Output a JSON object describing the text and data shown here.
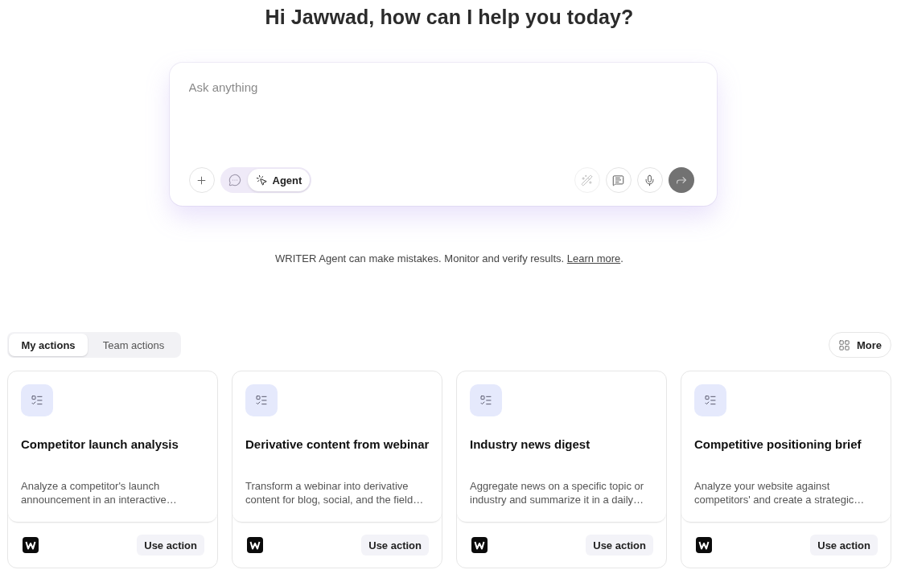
{
  "heading": "Hi Jawwad, how can I help you today?",
  "composer": {
    "placeholder": "Ask anything",
    "modes": [
      {
        "kind": "chat",
        "selected": false
      },
      {
        "kind": "agent",
        "label": "Agent",
        "selected": true
      }
    ],
    "tools": [
      {
        "kind": "enhance",
        "disabled": true
      },
      {
        "kind": "notes",
        "disabled": false
      },
      {
        "kind": "voice",
        "disabled": false
      }
    ],
    "send": {
      "disabled": true
    }
  },
  "disclaimer": {
    "text": "WRITER Agent can make mistakes. Monitor and verify results.",
    "link": "Learn more",
    "trailing": "."
  },
  "tabs": [
    {
      "label": "My actions",
      "selected": true
    },
    {
      "label": "Team actions",
      "selected": false
    }
  ],
  "more_button": {
    "label": "More"
  },
  "actions": [
    {
      "title": "Competitor launch analysis",
      "description": "Analyze a competitor's launch announcement in an interactive…",
      "button": "Use action"
    },
    {
      "title": "Derivative content from webinar",
      "description": "Transform a webinar into derivative content for blog, social, and the field…",
      "button": "Use action"
    },
    {
      "title": "Industry news digest",
      "description": "Aggregate news on a specific topic or industry and summarize it in a daily…",
      "button": "Use action"
    },
    {
      "title": "Competitive positioning brief",
      "description": "Analyze your website against competitors' and create a strategic…",
      "button": "Use action"
    }
  ]
}
